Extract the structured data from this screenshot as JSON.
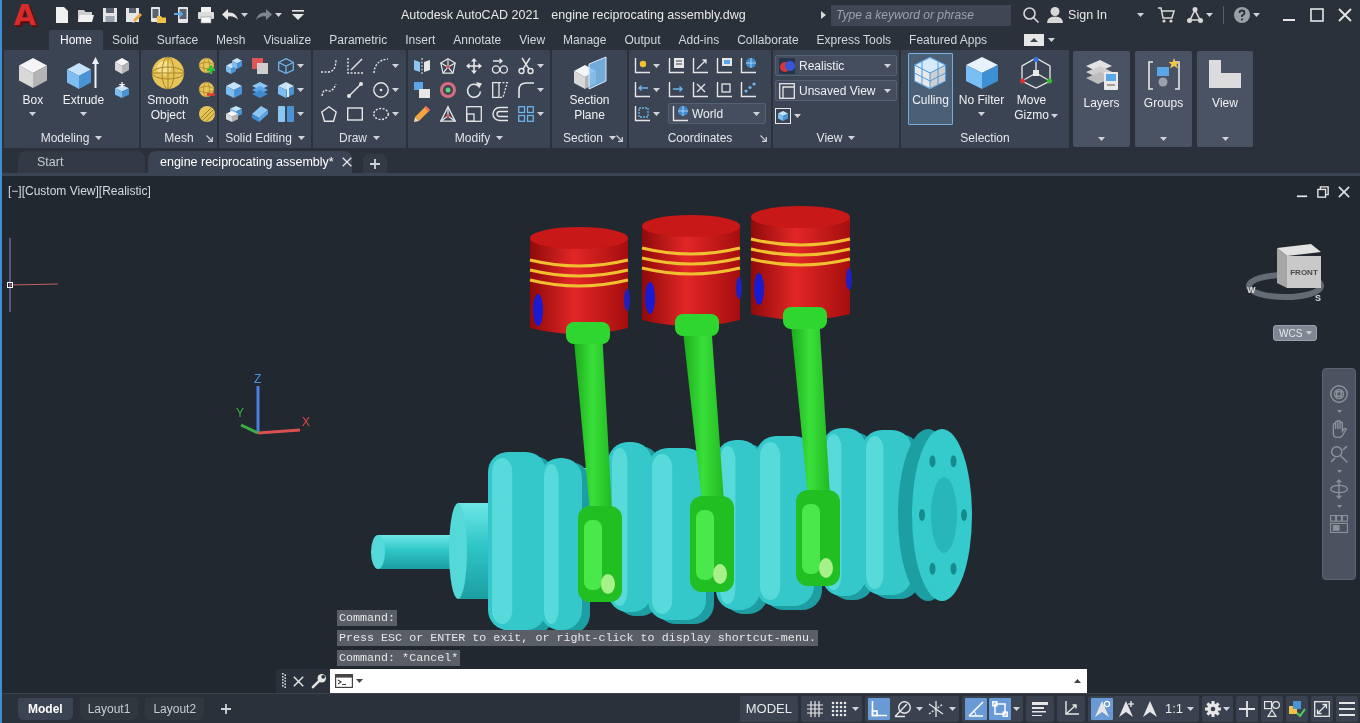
{
  "title_bar": {
    "logo": "A",
    "app_name": "Autodesk AutoCAD 2021",
    "file_name": "engine reciprocating assembly.dwg",
    "search": {
      "placeholder": "Type a keyword or phrase"
    },
    "sign_in": "Sign In"
  },
  "ribbon_tabs": [
    {
      "label": "Home",
      "selected": true
    },
    {
      "label": "Solid",
      "selected": false
    },
    {
      "label": "Surface",
      "selected": false
    },
    {
      "label": "Mesh",
      "selected": false
    },
    {
      "label": "Visualize",
      "selected": false
    },
    {
      "label": "Parametric",
      "selected": false
    },
    {
      "label": "Insert",
      "selected": false
    },
    {
      "label": "Annotate",
      "selected": false
    },
    {
      "label": "View",
      "selected": false
    },
    {
      "label": "Manage",
      "selected": false
    },
    {
      "label": "Output",
      "selected": false
    },
    {
      "label": "Add-ins",
      "selected": false
    },
    {
      "label": "Collaborate",
      "selected": false
    },
    {
      "label": "Express Tools",
      "selected": false
    },
    {
      "label": "Featured Apps",
      "selected": false
    }
  ],
  "ribbon_panels": [
    {
      "title": "Modeling",
      "menu": true,
      "launcher": false,
      "tools": [
        {
          "label": "Box",
          "menu": true,
          "on": false
        },
        {
          "label": "Extrude",
          "menu": true,
          "on": false
        }
      ]
    },
    {
      "title": "Mesh",
      "menu": false,
      "launcher": true,
      "tools": [
        {
          "label": "Smooth\nObject",
          "menu": false,
          "on": false
        }
      ]
    },
    {
      "title": "Solid Editing",
      "menu": true,
      "launcher": false
    },
    {
      "title": "Draw",
      "menu": true,
      "launcher": false
    },
    {
      "title": "Modify",
      "menu": true,
      "launcher": false
    },
    {
      "title": "Section",
      "menu": true,
      "launcher": true,
      "tools": [
        {
          "label": "Section\nPlane",
          "menu": false,
          "on": false
        }
      ]
    },
    {
      "title": "Coordinates",
      "menu": false,
      "launcher": true,
      "dropdowns": [
        {
          "value": "World"
        }
      ]
    },
    {
      "title": "View",
      "menu": true,
      "launcher": false,
      "dropdowns": [
        {
          "value": "Realistic"
        },
        {
          "value": "Unsaved View"
        }
      ]
    },
    {
      "title": "Selection",
      "menu": false,
      "launcher": false,
      "tools": [
        {
          "label": "Culling",
          "menu": false,
          "on": true
        },
        {
          "label": "No Filter",
          "menu": true,
          "on": false
        },
        {
          "label": "Move\nGizmo",
          "menu": true,
          "on": false
        }
      ]
    }
  ],
  "collapsed_panels": [
    {
      "label": "Layers"
    },
    {
      "label": "Groups"
    },
    {
      "label": "View"
    }
  ],
  "document_tabs": [
    {
      "label": "Start",
      "selected": false,
      "closable": false
    },
    {
      "label": "engine reciprocating assembly*",
      "selected": true,
      "closable": true
    }
  ],
  "viewport": {
    "controls": [
      "[−]",
      "[Custom View]",
      "[Realistic]"
    ],
    "ucs_axes": [
      "Z",
      "Y",
      "X"
    ],
    "viewcube": {
      "face": "FRONT",
      "compass": [
        "W",
        "S"
      ]
    },
    "coordinate_system": "WCS"
  },
  "command_line": {
    "history": [
      "Command:",
      "Press ESC or ENTER to exit, or right-click to display shortcut-menu.",
      "Command: *Cancel*"
    ]
  },
  "layout_tabs": [
    {
      "label": "Model",
      "selected": true
    },
    {
      "label": "Layout1",
      "selected": false
    },
    {
      "label": "Layout2",
      "selected": false
    }
  ],
  "status_bar": {
    "space": "MODEL",
    "toggles": [
      {
        "on": false,
        "menu": false
      },
      {
        "on": false,
        "menu": true
      },
      {
        "on": true,
        "menu": false
      },
      {
        "on": false,
        "menu": true
      },
      {
        "on": false,
        "menu": true
      },
      {
        "on": true,
        "menu": false
      },
      {
        "on": true,
        "menu": true
      },
      {
        "on": false,
        "menu": false
      },
      {
        "on": false,
        "menu": false
      },
      {
        "on": true,
        "menu": false
      },
      {
        "on": false,
        "menu": false
      },
      {
        "on": false,
        "menu": false
      }
    ],
    "annotation_scale": "1:1"
  }
}
